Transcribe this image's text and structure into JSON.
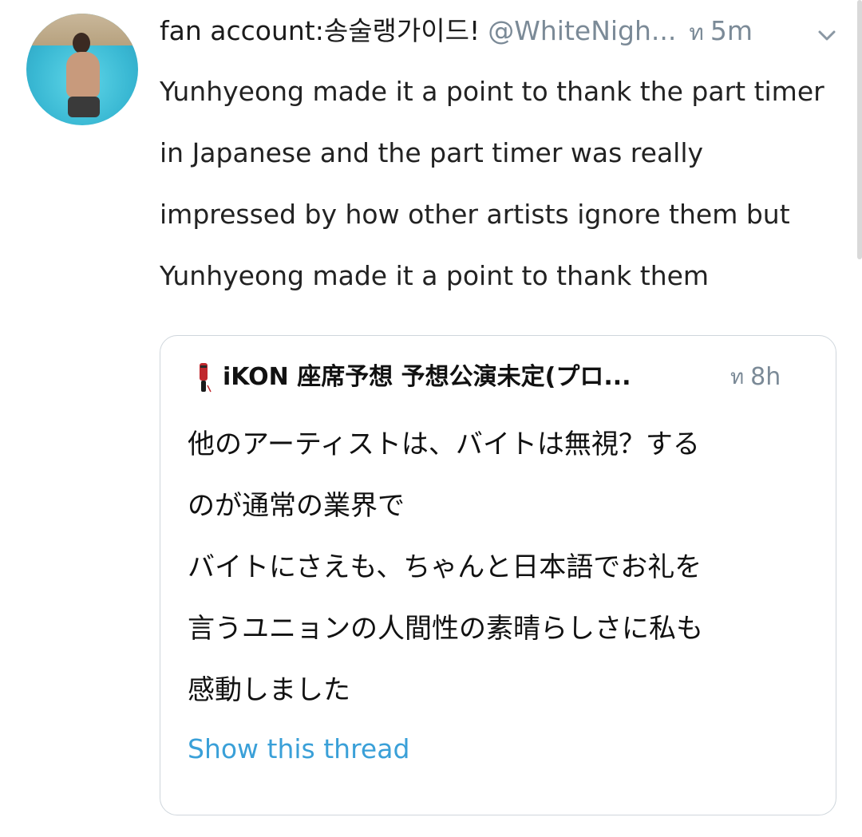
{
  "tweet": {
    "display_name": "fan account:송술랭가이드!",
    "handle": "@WhiteNigh...",
    "dot": "ท",
    "time": "5m",
    "text": "Yunhyeong made it a point to thank the part timer in Japanese and the part timer was really impressed by how other artists ignore them but Yunhyeong made it a point to thank them",
    "avatar_icon": "profile-photo",
    "caret_icon": "chevron-down-icon"
  },
  "quoted_tweet": {
    "name": "iKON 座席予想 予想公演未定(プロ...",
    "dot": "ท",
    "time": "8h",
    "icon": "lightstick-icon",
    "lines": [
      "他のアーティストは、バイトは無視？する",
      "のが通常の業界で",
      "バイトにさえも、ちゃんと日本語でお礼を",
      "言うユニョンの人間性の素晴らしさに私も",
      "感動しました"
    ],
    "show_thread": "Show this thread"
  },
  "colors": {
    "link": "#3aa0d8",
    "muted": "#7b8a97",
    "border": "#cfd6dc"
  }
}
